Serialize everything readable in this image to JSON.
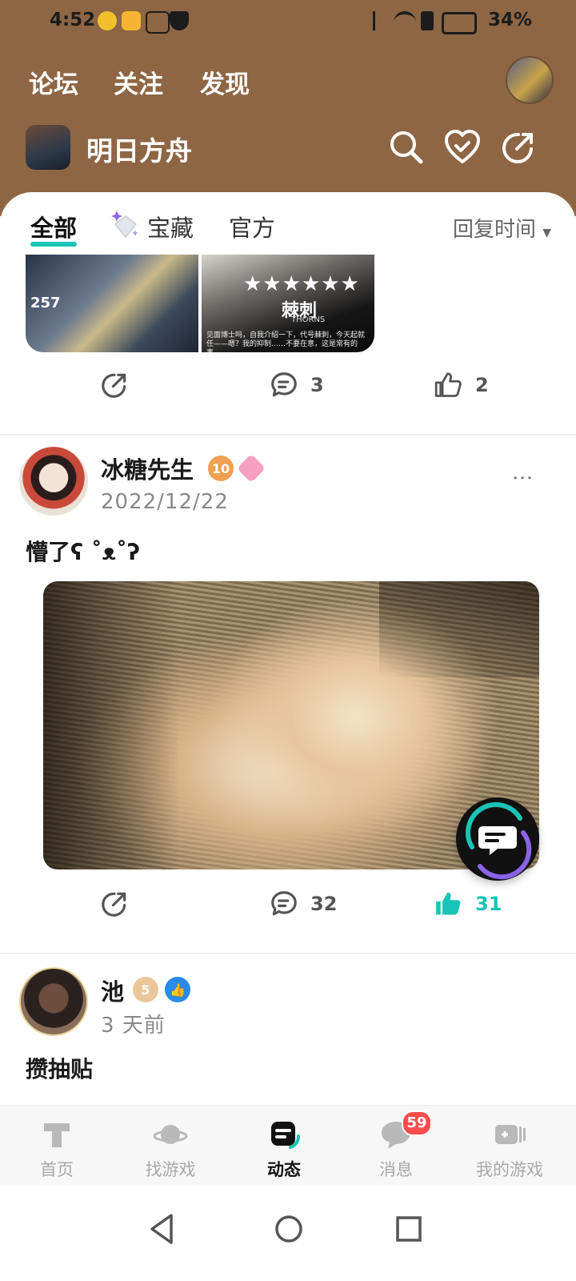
{
  "status_bar": {
    "time": "4:52",
    "battery": "34%"
  },
  "top_nav": {
    "tabs": [
      "论坛",
      "关注",
      "发现"
    ],
    "active_tab": "论坛"
  },
  "game": {
    "title": "明日方舟"
  },
  "filter_tabs": [
    "全部",
    "宝藏",
    "官方"
  ],
  "sort_label": "回复时间",
  "prev_post": {
    "thumb_a_text": "257",
    "thumb_b_stars": "★★★★★★",
    "thumb_b_name": "棘刺",
    "thumb_b_sub": "THORNS",
    "thumb_b_caption": "见面博士吗，自我介绍一下，代号棘刺，今天起就任——嗯？我的抑制……不要在意，这是常有的事。",
    "comments": "3",
    "likes": "2"
  },
  "posts": [
    {
      "author": "冰糖先生",
      "level_badge": "10",
      "date": "2022/12/22",
      "text": "懵了ʕ ˚ᴥ˚ʔ",
      "comments": "32",
      "likes": "31",
      "liked": true
    },
    {
      "author": "池",
      "level_badge": "5",
      "date": "3 天前",
      "text": "攒抽贴"
    }
  ],
  "bottom_nav": {
    "items": [
      "首页",
      "找游戏",
      "动态",
      "消息",
      "我的游戏"
    ],
    "active": "动态",
    "message_badge": "59"
  },
  "colors": {
    "header": "#8e6644",
    "accent": "#18c4b6",
    "badge": "#ff4d4f"
  }
}
